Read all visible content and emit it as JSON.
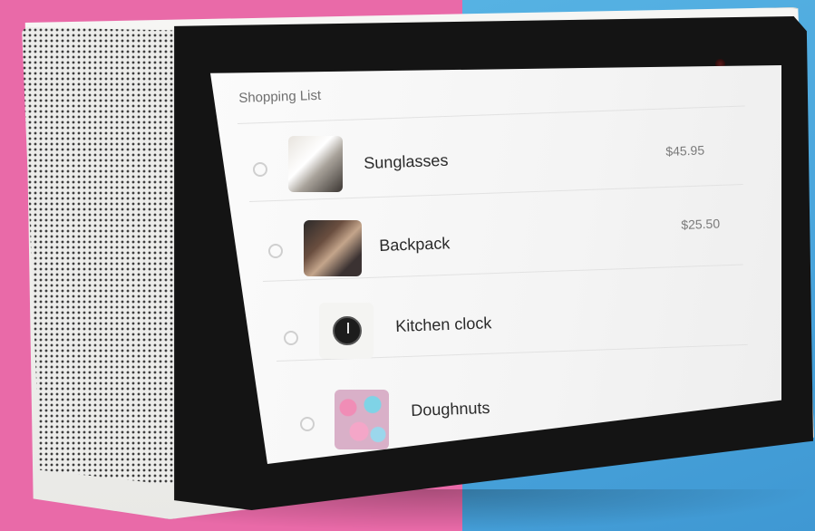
{
  "shopping_list": {
    "title": "Shopping List",
    "items": [
      {
        "name": "Sunglasses",
        "price": "$45.95",
        "checked": false
      },
      {
        "name": "Backpack",
        "price": "$25.50",
        "checked": false
      },
      {
        "name": "Kitchen clock",
        "price": "",
        "checked": false
      },
      {
        "name": "Doughnuts",
        "price": "",
        "checked": false
      }
    ]
  },
  "colors": {
    "background_left": "#e96aa8",
    "background_right": "#4aa5dc",
    "device_body": "#efefec",
    "bezel": "#141414",
    "screen": "#f6f6f6"
  }
}
